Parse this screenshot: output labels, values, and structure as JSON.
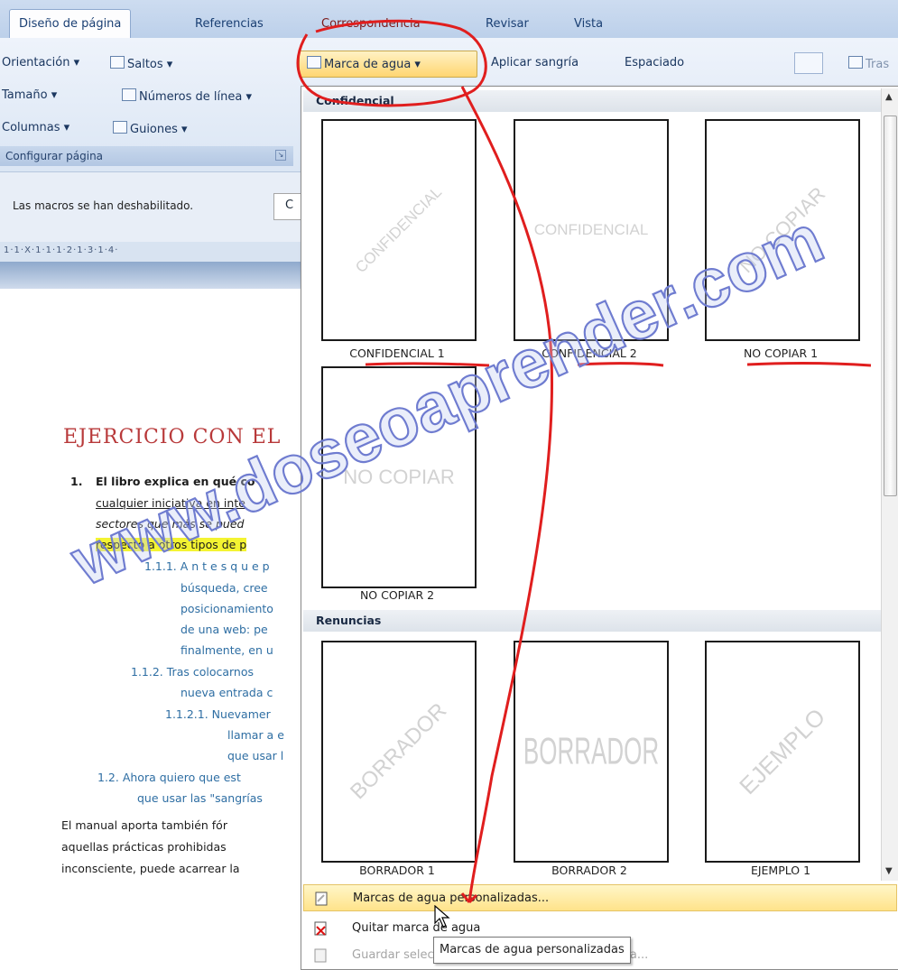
{
  "tabs": [
    "Diseño de página",
    "Referencias",
    "Correspondencia",
    "Revisar",
    "Vista"
  ],
  "ribbon": {
    "orientacion": "Orientación",
    "saltos": "Saltos",
    "tamano": "Tamaño",
    "numeros_linea": "Números de línea",
    "columnas": "Columnas",
    "guiones": "Guiones",
    "group_label": "Configurar página",
    "marca_agua": "Marca de agua",
    "aplicar_sangria": "Aplicar sangría",
    "espaciado": "Espaciado",
    "tras": "Tras"
  },
  "macro_bar": {
    "text": "Las macros se han deshabilitado.",
    "btn": "C"
  },
  "ruler": "1·1·X·1·1·1·2·1·3·1·4·",
  "document": {
    "title": "EJERCICIO CON EL",
    "item1_num": "1.",
    "item1_line1": "El libro explica en qué co",
    "item1_line2": "cualquier iniciativa en inte",
    "item1_line3": "sectores que más se pued",
    "item1_line4": "respecto a otros tipos de p",
    "l111_a": "1.1.1. A n t e s   q u e   p",
    "l111_b": "búsqueda, cree",
    "l111_c": "posicionamiento",
    "l111_d": "de una web: pe",
    "l111_e": "finalmente, en u",
    "l112_a": "1.1.2. Tras colocarnos",
    "l112_b": "nueva entrada c",
    "l1121_a": "1.1.2.1. Nuevamer",
    "l1121_b": "llamar a e",
    "l1121_c": "que usar l",
    "l12_a": "1.2.  Ahora quiero que est",
    "l12_b": "que usar las \"sangrías",
    "para1": "El manual aporta también fór",
    "para2": "aquellas prácticas prohibidas",
    "para3": "inconsciente, puede acarrear la"
  },
  "menu": {
    "section1": "Confidencial",
    "section2": "Renuncias",
    "thumbs": [
      {
        "label": "CONFIDENCIAL 1",
        "wm": "CONFIDENCIAL"
      },
      {
        "label": "CONFIDENCIAL 2",
        "wm": "CONFIDENCIAL"
      },
      {
        "label": "NO COPIAR 1",
        "wm": "NO COPIAR"
      },
      {
        "label": "NO COPIAR 2",
        "wm": "NO COPIAR"
      },
      {
        "label": "BORRADOR 1",
        "wm": "BORRADOR"
      },
      {
        "label": "BORRADOR 2",
        "wm": "BORRADOR"
      },
      {
        "label": "EJEMPLO 1",
        "wm": "EJEMPLO"
      }
    ],
    "item_custom": "Marcas de agua personalizadas...",
    "item_remove": "Quitar marca de agua",
    "item_save": "Guardar selección en galería de marcas de agua..."
  },
  "tooltip": "Marcas de agua personalizadas",
  "site_watermark": "www.doseoaprender.com"
}
